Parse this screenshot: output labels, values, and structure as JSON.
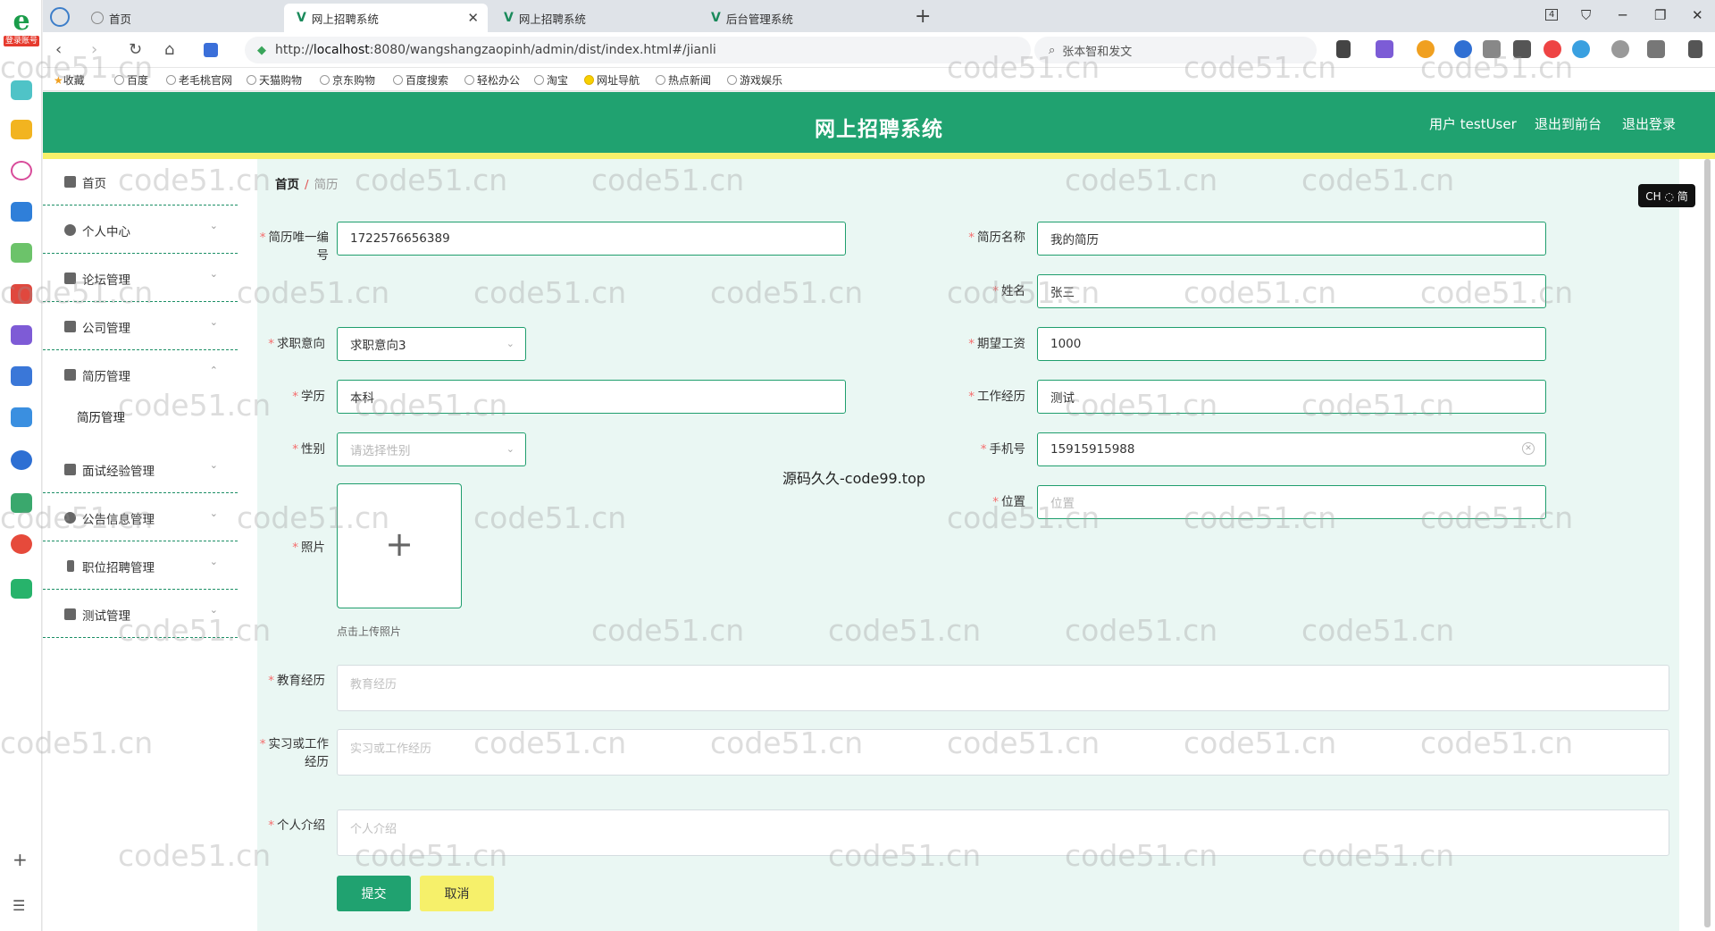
{
  "browser": {
    "side_badge": "登录账号",
    "tabs": [
      {
        "label": "首页"
      },
      {
        "label": "网上招聘系统",
        "close": "✕"
      },
      {
        "label": "网上招聘系统"
      },
      {
        "label": "后台管理系统"
      }
    ],
    "tab_count": "4",
    "url_prefix": "http://",
    "url_host": "localhost",
    "url_rest": ":8080/wangshangzaopinh/admin/dist/index.html#/jianli",
    "search_text": "张本智和发文",
    "bookmarks": [
      "收藏",
      "百度",
      "老毛桃官网",
      "天猫购物",
      "京东购物",
      "百度搜索",
      "轻松办公",
      "淘宝",
      "网址导航",
      "热点新闻",
      "游戏娱乐"
    ]
  },
  "header": {
    "title": "网上招聘系统",
    "user": "用户 testUser",
    "back_front": "退出到前台",
    "logout": "退出登录"
  },
  "sidebar": {
    "items": [
      {
        "label": "首页",
        "chevron": ""
      },
      {
        "label": "个人中心",
        "chevron": "⌄"
      },
      {
        "label": "论坛管理",
        "chevron": "⌄"
      },
      {
        "label": "公司管理",
        "chevron": "⌄"
      },
      {
        "label": "简历管理",
        "chevron": "⌃"
      },
      {
        "label": "面试经验管理",
        "chevron": "⌄"
      },
      {
        "label": "公告信息管理",
        "chevron": "⌄"
      },
      {
        "label": "职位招聘管理",
        "chevron": "⌄"
      },
      {
        "label": "测试管理",
        "chevron": "⌄"
      }
    ],
    "sub_item": "简历管理"
  },
  "breadcrumb": {
    "home": "首页",
    "sep": "/",
    "current": "简历"
  },
  "form": {
    "resume_no": {
      "label": "简历唯一编号",
      "value": "1722576656389"
    },
    "resume_name": {
      "label": "简历名称",
      "value": "我的简历"
    },
    "name": {
      "label": "姓名",
      "value": "张三"
    },
    "intent": {
      "label": "求职意向",
      "value": "求职意向3"
    },
    "salary": {
      "label": "期望工资",
      "value": "1000"
    },
    "education": {
      "label": "学历",
      "value": "本科"
    },
    "work_exp": {
      "label": "工作经历",
      "value": "测试"
    },
    "gender": {
      "label": "性别",
      "placeholder": "请选择性别"
    },
    "phone": {
      "label": "手机号",
      "value": "15915915988"
    },
    "location": {
      "label": "位置",
      "placeholder": "位置"
    },
    "photo": {
      "label": "照片",
      "tip": "点击上传照片"
    },
    "edu_history": {
      "label": "教育经历",
      "placeholder": "教育经历"
    },
    "intern": {
      "label": "实习或工作经历",
      "placeholder": "实习或工作经历"
    },
    "intro": {
      "label": "个人介绍",
      "placeholder": "个人介绍"
    },
    "submit": "提交",
    "cancel": "取消"
  },
  "overlay": {
    "center_text": "源码久久-code99.top",
    "ime": "CH ◌ 简",
    "watermark": "code51.cn"
  }
}
